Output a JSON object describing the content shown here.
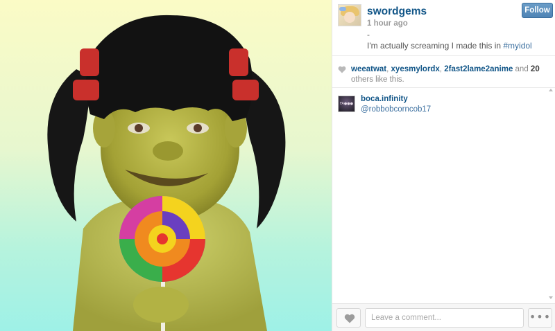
{
  "post": {
    "username": "swordgems",
    "time": "1 hour ago",
    "follow_label": "Follow",
    "caption_dash": "-",
    "caption_text": "I'm actually screaming I made this in ",
    "caption_tag": "#myidol"
  },
  "likes": {
    "users": [
      "weeatwat",
      "xyesmylordx",
      "2fast2lame2anime"
    ],
    "sep1": ", ",
    "sep2": ", ",
    "sep3": " and ",
    "count": "20",
    "suffix": " others like this."
  },
  "comments": [
    {
      "user": "boca.infinity",
      "text": "@robbobcorncob17",
      "avatar_text": "FA●●●"
    }
  ],
  "footer": {
    "comment_placeholder": "Leave a comment...",
    "more_label": "•••"
  },
  "icons": {
    "heart": "heart-icon",
    "more": "more-icon"
  },
  "colors": {
    "link": "#125688",
    "tag": "#3b6f9f",
    "follow_bg": "#5b8fbe"
  }
}
